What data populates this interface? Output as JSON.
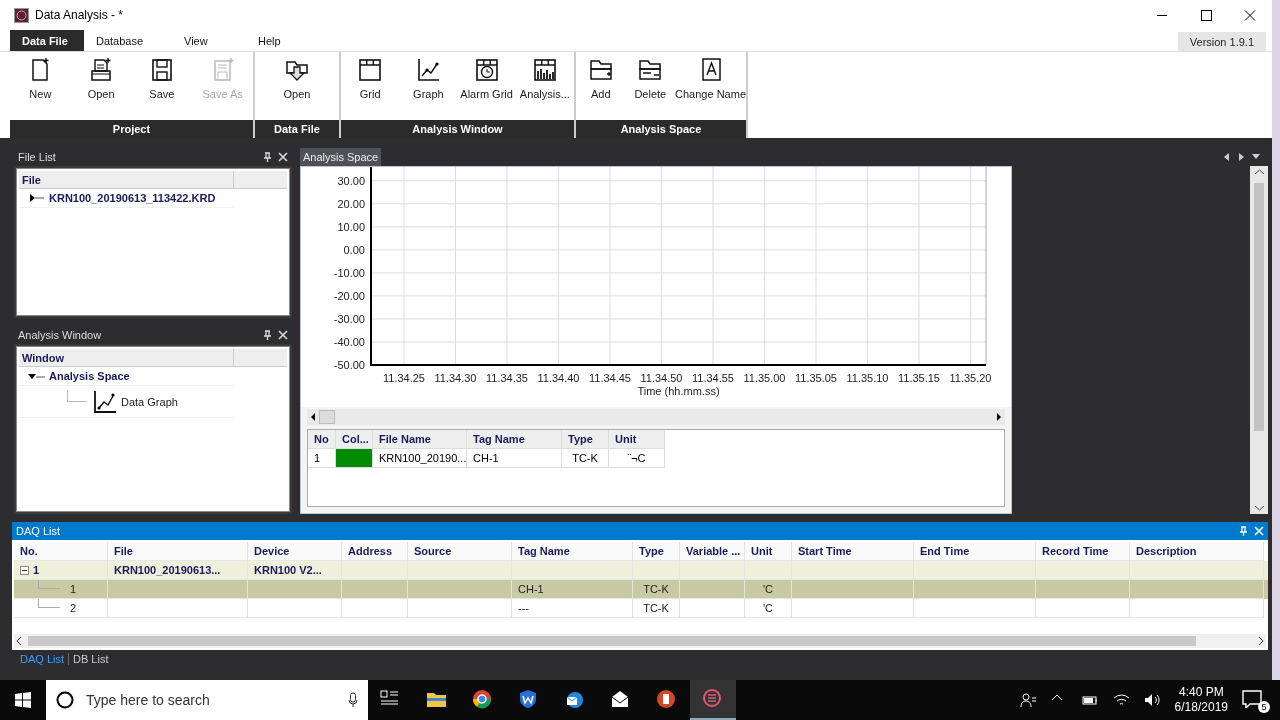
{
  "window": {
    "title": "Data Analysis - *"
  },
  "menu_tabs": [
    {
      "label": "Data File",
      "selected": true
    },
    {
      "label": "Database",
      "selected": false
    },
    {
      "label": "View",
      "selected": false
    },
    {
      "label": "Help",
      "selected": false
    }
  ],
  "version": "Version 1.9.1",
  "ribbon_groups": [
    {
      "label": "Project",
      "buttons": [
        {
          "label": "New",
          "disabled": false
        },
        {
          "label": "Open",
          "disabled": false
        },
        {
          "label": "Save",
          "disabled": false
        },
        {
          "label": "Save As",
          "disabled": true
        }
      ]
    },
    {
      "label": "Data File",
      "buttons": [
        {
          "label": "Open",
          "disabled": false
        }
      ]
    },
    {
      "label": "Analysis Window",
      "buttons": [
        {
          "label": "Grid",
          "disabled": false
        },
        {
          "label": "Graph",
          "disabled": false
        },
        {
          "label": "Alarm Grid",
          "disabled": false
        },
        {
          "label": "Analysis...",
          "disabled": false
        }
      ]
    },
    {
      "label": "Analysis Space",
      "buttons": [
        {
          "label": "Add",
          "disabled": false
        },
        {
          "label": "Delete",
          "disabled": false
        },
        {
          "label": "Change Name",
          "disabled": false
        }
      ]
    }
  ],
  "file_list": {
    "title": "File List",
    "column": "File",
    "items": [
      {
        "label": "KRN100_20190613_113422.KRD",
        "expanded": false
      }
    ]
  },
  "analysis_window": {
    "title": "Analysis Window",
    "column": "Window",
    "items": [
      {
        "label": "Analysis Space",
        "expanded": true,
        "children": [
          {
            "label": "Data Graph"
          }
        ]
      }
    ]
  },
  "analysis_space": {
    "tab": "Analysis Space",
    "chart_data": {
      "type": "line",
      "grid": true,
      "xlabel": "Time (hh.mm.ss)",
      "categories": [
        "11.34.25",
        "11.34.30",
        "11.34.35",
        "11.34.40",
        "11.34.45",
        "11.34.50",
        "11.34.55",
        "11.35.00",
        "11.35.05",
        "11.35.10",
        "11.35.15",
        "11.35.20"
      ],
      "ylim": [
        -50,
        36
      ],
      "yticks": [
        {
          "value": 30,
          "label": "30.00"
        },
        {
          "value": 20,
          "label": "20.00"
        },
        {
          "value": 10,
          "label": "10.00"
        },
        {
          "value": 0,
          "label": "0.00"
        },
        {
          "value": -10,
          "label": "-10.00"
        },
        {
          "value": -20,
          "label": "-20.00"
        },
        {
          "value": -30,
          "label": "-30.00"
        },
        {
          "value": -40,
          "label": "-40.00"
        },
        {
          "value": -50,
          "label": "-50.00"
        }
      ]
    },
    "table": {
      "columns": [
        "No",
        "Col...",
        "File Name",
        "Tag Name",
        "Type",
        "Unit"
      ],
      "rows": [
        {
          "no": "1",
          "color": "#008c00",
          "file_name": "KRN100_20190...",
          "tag_name": "CH-1",
          "type": "TC-K",
          "unit": "¨¬C"
        }
      ]
    }
  },
  "daq_list": {
    "title": "DAQ List",
    "columns": [
      "No.",
      "File",
      "Device",
      "Address",
      "Source",
      "Tag Name",
      "Type",
      "Variable ...",
      "Unit",
      "Start Time",
      "End Time",
      "Record Time",
      "Description"
    ],
    "rows": [
      {
        "no": "1",
        "file": "KRN100_20190613...",
        "device": "KRN100 V2...",
        "expanded": true,
        "selected": false,
        "children": [
          {
            "no": "1",
            "tag_name": "CH-1",
            "type": "TC-K",
            "unit": "'C",
            "selected": true
          },
          {
            "no": "2",
            "tag_name": "---",
            "type": "TC-K",
            "unit": "'C",
            "selected": false
          }
        ]
      }
    ]
  },
  "bottom_tabs": [
    {
      "label": "DAQ List",
      "selected": true
    },
    {
      "label": "DB List",
      "selected": false
    }
  ],
  "taskbar": {
    "search_placeholder": "Type here to search",
    "time": "4:40 PM",
    "date": "6/18/2019",
    "notification_count": "5"
  }
}
